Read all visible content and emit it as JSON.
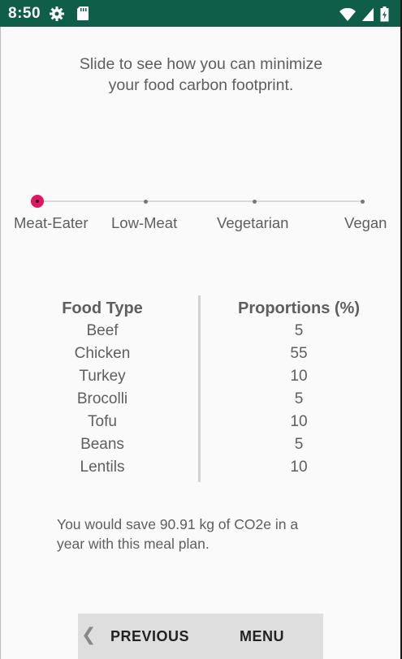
{
  "status_bar": {
    "time": "8:50",
    "icons_left": [
      "gear-icon",
      "sd-card-icon"
    ],
    "icons_right": [
      "wifi-icon",
      "signal-icon",
      "battery-icon"
    ],
    "color": "#0f5e4a"
  },
  "headline": {
    "line1": "Slide to see how you can minimize",
    "line2": "your food carbon footprint."
  },
  "slider": {
    "options": [
      "Meat-Eater",
      "Low-Meat",
      "Vegetarian",
      "Vegan"
    ],
    "selected_index": 0,
    "thumb_color": "#e01563"
  },
  "table": {
    "headers": [
      "Food Type",
      "Proportions (%)"
    ],
    "rows": [
      {
        "food": "Beef",
        "pct": "5"
      },
      {
        "food": "Chicken",
        "pct": "55"
      },
      {
        "food": "Turkey",
        "pct": "10"
      },
      {
        "food": "Brocolli",
        "pct": "5"
      },
      {
        "food": "Tofu",
        "pct": "10"
      },
      {
        "food": "Beans",
        "pct": "5"
      },
      {
        "food": "Lentils",
        "pct": "10"
      }
    ]
  },
  "savings": {
    "line1": "You would save 90.91 kg of CO2e in a",
    "line2": "year with this meal plan."
  },
  "nav": {
    "chevron": "❮",
    "previous_label": "PREVIOUS",
    "menu_label": "MENU"
  }
}
